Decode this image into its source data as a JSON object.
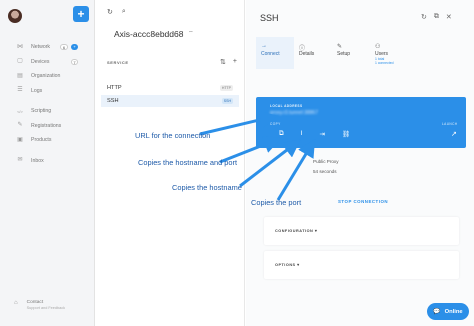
{
  "sidebar": {
    "add_label": "+",
    "items": [
      {
        "label": "Network",
        "icon": "network-icon",
        "glyph": "⋈",
        "count": "6",
        "badge": "+",
        "badge_style": "blue"
      },
      {
        "label": "Devices",
        "icon": "devices-icon",
        "glyph": "▢",
        "count": "",
        "badge": "7",
        "badge_style": "white"
      },
      {
        "label": "Organization",
        "icon": "organization-icon",
        "glyph": "▤",
        "count": "",
        "badge": ""
      },
      {
        "label": "Logs",
        "icon": "logs-icon",
        "glyph": "☰",
        "count": "",
        "badge": ""
      },
      {
        "label": "Scripting",
        "icon": "scripting-icon",
        "glyph": "</>",
        "count": "",
        "badge": ""
      },
      {
        "label": "Registrations",
        "icon": "registrations-icon",
        "glyph": "✎",
        "count": "",
        "badge": ""
      },
      {
        "label": "Products",
        "icon": "products-icon",
        "glyph": "▣",
        "count": "",
        "badge": ""
      },
      {
        "label": "Inbox",
        "icon": "inbox-icon",
        "glyph": "✉",
        "count": "",
        "badge": ""
      }
    ],
    "footer": {
      "label": "Contact",
      "sub": "Support and Feedback"
    }
  },
  "middle": {
    "device_name": "Axis-accc8ebdd68",
    "service_header": "SERVICE",
    "services": [
      {
        "name": "HTTP",
        "protocol": "HTTP"
      },
      {
        "name": "SSH",
        "protocol": "SSH"
      }
    ]
  },
  "right": {
    "title": "SSH",
    "tabs": [
      {
        "label": "Connect",
        "icon": "arrow-right-icon",
        "glyph": "→",
        "sub": "",
        "sub2": ""
      },
      {
        "label": "Details",
        "icon": "info-icon",
        "glyph": "ⓘ",
        "sub": "",
        "sub2": ""
      },
      {
        "label": "Setup",
        "icon": "edit-icon",
        "glyph": "✎",
        "sub": "",
        "sub2": ""
      },
      {
        "label": "Users",
        "icon": "users-icon",
        "glyph": "⚇",
        "sub": "1 total",
        "sub2": "1 connected"
      }
    ],
    "card": {
      "local_address_label": "LOCAL ADDRESS",
      "local_address": "proxy.r3.tunnel:38867",
      "copy_label": "COPY",
      "launch_label": "LAUNCH"
    },
    "status_lines": [
      "Public Proxy",
      "54 seconds"
    ],
    "stop_label": "STOP CONNECTION",
    "sections": [
      "CONFIGURATION",
      "OPTIONS"
    ],
    "online_label": "Online"
  },
  "annotations": {
    "url": "URL for the connection",
    "hostname_port": "Copies the hostname and port",
    "hostname": "Copies the hostname",
    "port": "Copies the port"
  },
  "colors": {
    "accent": "#2b8fe8",
    "annotation": "#1d5aa8"
  }
}
